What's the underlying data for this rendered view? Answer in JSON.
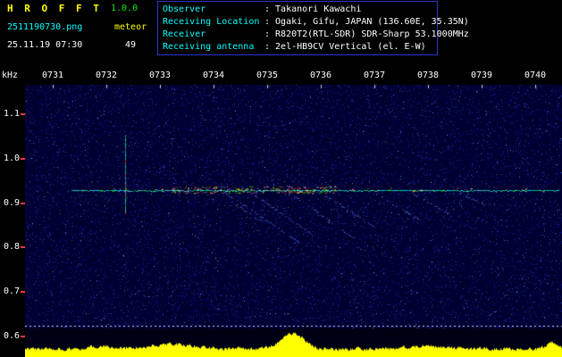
{
  "header": {
    "app_name": "H R O F F T",
    "version": "1.0.0",
    "filename": "2511190730.png",
    "mode": "meteor",
    "datetime": "25.11.19 07:30",
    "echo_count": "49",
    "info_rows": [
      {
        "label": "Observer",
        "value": ": Takanori Kawachi"
      },
      {
        "label": "Receiving Location",
        "value": ": Ogaki, Gifu, JAPAN (136.60E, 35.35N)"
      },
      {
        "label": "Receiver",
        "value": ": R820T2(RTL-SDR) SDR-Sharp 53.1000MHz"
      },
      {
        "label": "Receiving antenna",
        "value": ": 2el-HB9CV Vertical (el. E-W)"
      }
    ]
  },
  "colors": {
    "app_title": "#ffff00",
    "version": "#00ee00",
    "filename": "#00ffff",
    "mode": "#ffff00",
    "datetime": "#ffffff",
    "info_label": "#00ffff",
    "info_value": "#ffffff",
    "info_border": "#2a35d0",
    "plot_bg": "#000030",
    "noise": [
      "#000078",
      "#0000b0",
      "#1828c8",
      "#2840e0",
      "#102898",
      "#3858f0"
    ],
    "noise_bright": [
      "#66a0ff",
      "#88c4ff",
      "#50e0d0",
      "#30c060"
    ],
    "carrier": [
      "#00e8d8",
      "#00d060",
      "#40ffb0",
      "#00ffff"
    ],
    "echo": [
      "#ff3030",
      "#ff8000",
      "#ffff00",
      "#00ff00",
      "#ffffff",
      "#ff60ff"
    ],
    "trail": "#7090ff",
    "axis_text": "#ffffff",
    "y_tick": "#ff3344",
    "x_tick": "#cccccc",
    "dotted_line": "#ffffff",
    "meter_fill": "#ffff00",
    "meter_bg": "#000014"
  },
  "chart_data": {
    "type": "heatmap",
    "subtype": "meteor-radio-spectrogram",
    "title": "",
    "xlabel": "",
    "ylabel": "kHz",
    "x_tick_labels": [
      "0731",
      "0732",
      "0733",
      "0734",
      "0735",
      "0736",
      "0737",
      "0738",
      "0739",
      "0740"
    ],
    "x_tick_minutes": [
      731,
      732,
      733,
      734,
      735,
      736,
      737,
      738,
      739,
      740
    ],
    "xlim": [
      730.483,
      740.5
    ],
    "y_tick_labels": [
      "1.1",
      "1.0",
      "0.9",
      "0.8",
      "0.7",
      "0.6"
    ],
    "y_tick_values": [
      1.1,
      1.0,
      0.9,
      0.8,
      0.7,
      0.6
    ],
    "ylim": [
      0.618,
      1.166
    ],
    "grid": false,
    "carrier": {
      "khz": 0.93,
      "start_min": 731.35,
      "end_min": 740.45
    },
    "vertical_streaks": [
      {
        "minute": 732.35,
        "f_top": 1.052,
        "f_bottom": 0.878
      }
    ],
    "trails": [
      {
        "m0": 734.2,
        "f0": 0.924,
        "m1": 735.6,
        "f1": 0.812
      },
      {
        "m0": 734.77,
        "f0": 0.918,
        "m1": 735.9,
        "f1": 0.824
      },
      {
        "m0": 735.5,
        "f0": 0.916,
        "m1": 736.7,
        "f1": 0.814
      },
      {
        "m0": 736.05,
        "f0": 0.92,
        "m1": 737.0,
        "f1": 0.846
      },
      {
        "m0": 737.0,
        "f0": 0.922,
        "m1": 737.85,
        "f1": 0.862
      },
      {
        "m0": 737.65,
        "f0": 0.924,
        "m1": 738.4,
        "f1": 0.876
      },
      {
        "m0": 734.4,
        "f0": 0.898,
        "m1": 735.1,
        "f1": 0.842
      },
      {
        "m0": 738.6,
        "f0": 0.922,
        "m1": 739.05,
        "f1": 0.896
      }
    ],
    "echo_clusters": [
      {
        "m0": 733.2,
        "m1": 736.3,
        "khz": 0.93,
        "spread": 0.008,
        "count": 260
      },
      {
        "m0": 731.4,
        "m1": 740.3,
        "khz": 0.93,
        "spread": 0.004,
        "count": 80
      }
    ],
    "level_meter": {
      "base": 0.18,
      "jitter": 0.2,
      "peaks": [
        {
          "minute": 735.45,
          "height": 0.55,
          "width": 0.3
        },
        {
          "minute": 733.2,
          "height": 0.16,
          "width": 0.6
        },
        {
          "minute": 731.9,
          "height": 0.1,
          "width": 0.35
        },
        {
          "minute": 737.9,
          "height": 0.1,
          "width": 0.5
        },
        {
          "minute": 740.3,
          "height": 0.22,
          "width": 0.15
        }
      ]
    },
    "noise_density": 16000,
    "noise_bright_count": 800
  }
}
